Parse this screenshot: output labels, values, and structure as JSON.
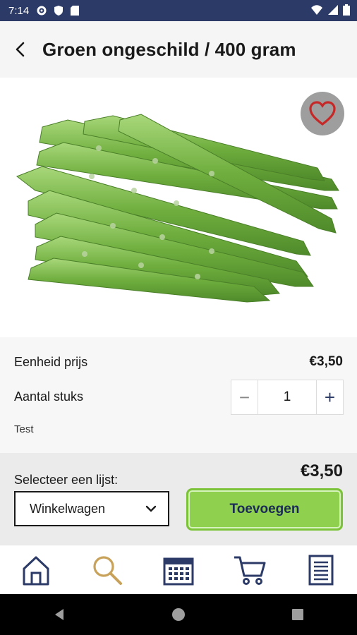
{
  "status": {
    "time": "7:14"
  },
  "header": {
    "title": "Groen ongeschild / 400 gram"
  },
  "product": {
    "unit_price_label": "Eenheid prijs",
    "unit_price": "€3,50",
    "quantity_label": "Aantal stuks",
    "quantity": "1",
    "minus": "−",
    "plus": "+",
    "note": "Test"
  },
  "action": {
    "total": "€3,50",
    "select_label": "Selecteer een lijst:",
    "selected_list": "Winkelwagen",
    "add_button": "Toevoegen"
  },
  "colors": {
    "brand": "#2b3a67",
    "accent_green": "#8fd14f",
    "favorite": "#c62828",
    "search_icon": "#c8a25a"
  },
  "icons": {
    "nav": [
      "home-icon",
      "search-icon",
      "calendar-icon",
      "cart-icon",
      "list-icon"
    ]
  }
}
